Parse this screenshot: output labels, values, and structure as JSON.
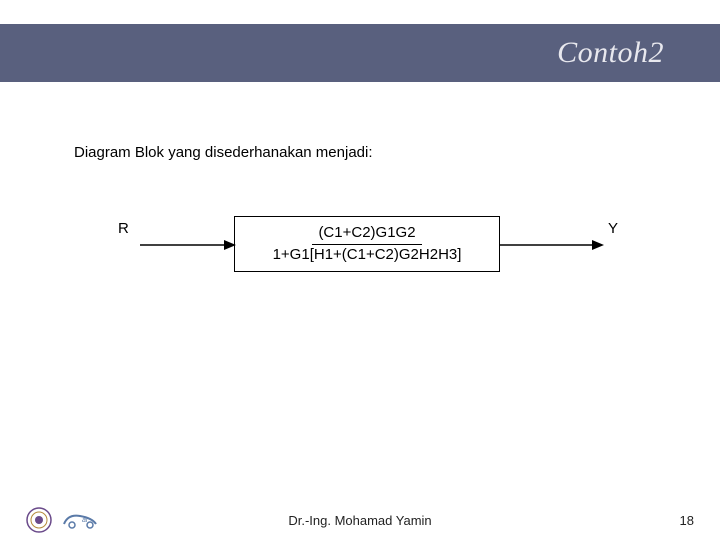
{
  "header": {
    "title": "Contoh2"
  },
  "subtitle": "Diagram Blok yang disederhanakan menjadi:",
  "diagram": {
    "input_label": "R",
    "output_label": "Y",
    "block": {
      "numerator": "(C1+C2)G1G2",
      "denominator": "1+G1[H1+(C1+C2)G2H2H3]"
    }
  },
  "footer": {
    "author": "Dr.-Ing. Mohamad Yamin",
    "page": "18"
  },
  "icons": {
    "logo_seal": "university-seal-icon",
    "logo_car": "car-logo-icon"
  }
}
